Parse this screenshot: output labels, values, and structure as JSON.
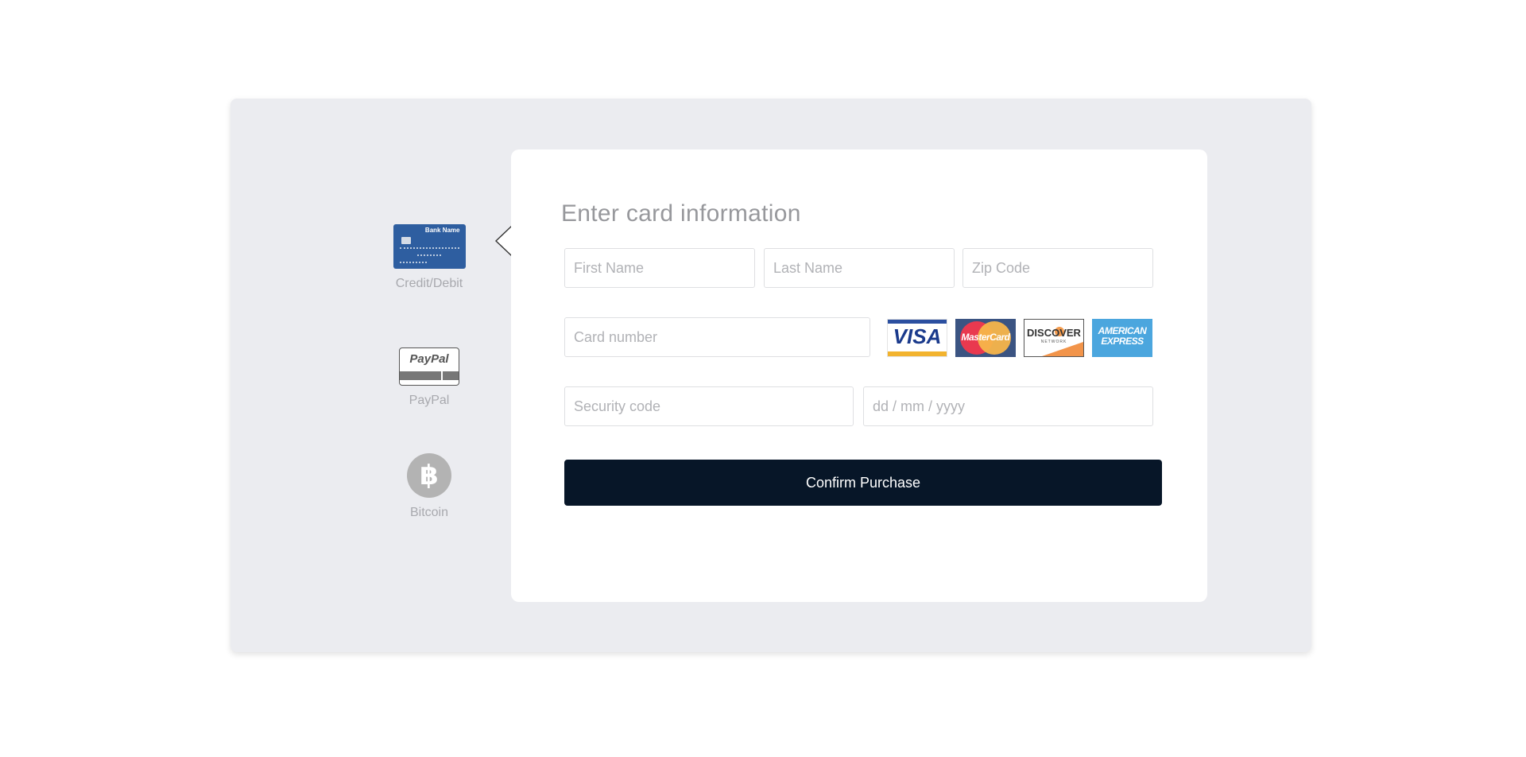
{
  "payment_methods": [
    {
      "label": "Credit/Debit",
      "icon": "credit-card-icon",
      "card_bank_text": "Bank Name"
    },
    {
      "label": "PayPal",
      "icon": "paypal-icon",
      "logo_text": "PayPal"
    },
    {
      "label": "Bitcoin",
      "icon": "bitcoin-icon",
      "glyph": "฿"
    }
  ],
  "form": {
    "title": "Enter card information",
    "first_name_placeholder": "First Name",
    "last_name_placeholder": "Last Name",
    "zip_placeholder": "Zip Code",
    "card_number_placeholder": "Card number",
    "security_code_placeholder": "Security code",
    "date_placeholder": "dd / mm / yyyy",
    "confirm_label": "Confirm Purchase"
  },
  "card_brands": {
    "visa": "VISA",
    "mastercard": "MasterCard",
    "discover": "DISCOVER",
    "discover_sub": "NETWORK",
    "amex_line1": "AMERICAN",
    "amex_line2": "EXPRESS"
  },
  "colors": {
    "panel_background": "#ebecf0",
    "button_background": "#071628",
    "button_text": "#ffffff"
  }
}
